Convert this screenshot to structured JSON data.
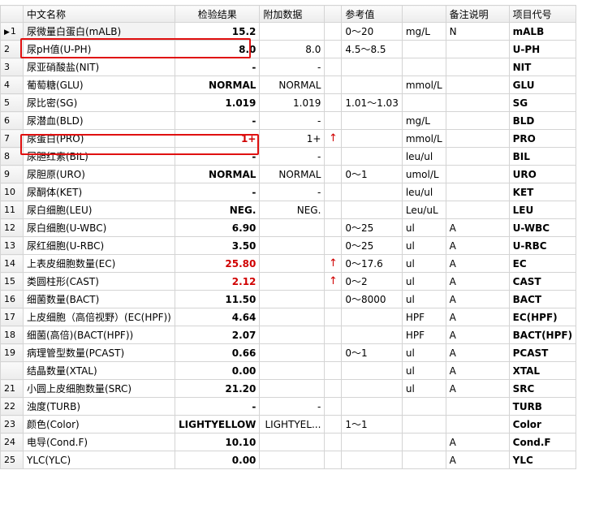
{
  "headers": [
    "",
    "中文名称",
    "检验结果",
    "附加数据",
    "",
    "参考值",
    "",
    "备注说明",
    "项目代号"
  ],
  "rows": [
    {
      "no": "1",
      "name": "尿微量白蛋白(mALB)",
      "result": "15.2",
      "extra": "",
      "flag": "",
      "ref": "0～20",
      "unit": "mg/L",
      "note": "N",
      "code": "mALB",
      "high": false
    },
    {
      "no": "2",
      "name": "尿pH值(U-PH)",
      "result": "8.0",
      "extra": "8.0",
      "flag": "",
      "ref": "4.5～8.5",
      "unit": "",
      "note": "",
      "code": "U-PH",
      "high": false
    },
    {
      "no": "3",
      "name": "尿亚硝酸盐(NIT)",
      "result": "-",
      "extra": "-",
      "flag": "",
      "ref": "",
      "unit": "",
      "note": "",
      "code": "NIT",
      "high": false
    },
    {
      "no": "4",
      "name": "葡萄糖(GLU)",
      "result": "NORMAL",
      "extra": "NORMAL",
      "flag": "",
      "ref": "",
      "unit": "mmol/L",
      "note": "",
      "code": "GLU",
      "high": false
    },
    {
      "no": "5",
      "name": "尿比密(SG)",
      "result": "1.019",
      "extra": "1.019",
      "flag": "",
      "ref": "1.01～1.03",
      "unit": "",
      "note": "",
      "code": "SG",
      "high": false
    },
    {
      "no": "6",
      "name": "尿潜血(BLD)",
      "result": "-",
      "extra": "-",
      "flag": "",
      "ref": "",
      "unit": "mg/L",
      "note": "",
      "code": "BLD",
      "high": false
    },
    {
      "no": "7",
      "name": "尿蛋白(PRO)",
      "result": "1+",
      "extra": "1+",
      "flag": "↑",
      "ref": "",
      "unit": "mmol/L",
      "note": "",
      "code": "PRO",
      "high": true
    },
    {
      "no": "8",
      "name": "尿胆红素(BIL)",
      "result": "-",
      "extra": "-",
      "flag": "",
      "ref": "",
      "unit": "leu/ul",
      "note": "",
      "code": "BIL",
      "high": false
    },
    {
      "no": "9",
      "name": "尿胆原(URO)",
      "result": "NORMAL",
      "extra": "NORMAL",
      "flag": "",
      "ref": "0～1",
      "unit": "umol/L",
      "note": "",
      "code": "URO",
      "high": false
    },
    {
      "no": "10",
      "name": "尿酮体(KET)",
      "result": "-",
      "extra": "-",
      "flag": "",
      "ref": "",
      "unit": "leu/ul",
      "note": "",
      "code": "KET",
      "high": false
    },
    {
      "no": "11",
      "name": "尿白细胞(LEU)",
      "result": "NEG.",
      "extra": "NEG.",
      "flag": "",
      "ref": "",
      "unit": "Leu/uL",
      "note": "",
      "code": "LEU",
      "high": false
    },
    {
      "no": "12",
      "name": "尿白细胞(U-WBC)",
      "result": "6.90",
      "extra": "",
      "flag": "",
      "ref": "0～25",
      "unit": "ul",
      "note": "A",
      "code": "U-WBC",
      "high": false
    },
    {
      "no": "13",
      "name": "尿红细胞(U-RBC)",
      "result": "3.50",
      "extra": "",
      "flag": "",
      "ref": "0～25",
      "unit": "ul",
      "note": "A",
      "code": "U-RBC",
      "high": false
    },
    {
      "no": "14",
      "name": "上表皮细胞数量(EC)",
      "result": "25.80",
      "extra": "",
      "flag": "↑",
      "ref": "0～17.6",
      "unit": "ul",
      "note": "A",
      "code": "EC",
      "high": true
    },
    {
      "no": "15",
      "name": "类圆柱形(CAST)",
      "result": "2.12",
      "extra": "",
      "flag": "↑",
      "ref": "0～2",
      "unit": "ul",
      "note": "A",
      "code": "CAST",
      "high": true
    },
    {
      "no": "16",
      "name": "细菌数量(BACT)",
      "result": "11.50",
      "extra": "",
      "flag": "",
      "ref": "0～8000",
      "unit": "ul",
      "note": "A",
      "code": "BACT",
      "high": false
    },
    {
      "no": "17",
      "name": "上皮细胞（高倍视野）(EC(HPF))",
      "result": "4.64",
      "extra": "",
      "flag": "",
      "ref": "",
      "unit": "HPF",
      "note": "A",
      "code": "EC(HPF)",
      "high": false
    },
    {
      "no": "18",
      "name": "细菌(高倍)(BACT(HPF))",
      "result": "2.07",
      "extra": "",
      "flag": "",
      "ref": "",
      "unit": "HPF",
      "note": "A",
      "code": "BACT(HPF)",
      "high": false
    },
    {
      "no": "19",
      "name": "病理管型数量(PCAST)",
      "result": "0.66",
      "extra": "",
      "flag": "",
      "ref": "0～1",
      "unit": "ul",
      "note": "A",
      "code": "PCAST",
      "high": false
    },
    {
      "no": "",
      "name": "结晶数量(XTAL)",
      "result": "0.00",
      "extra": "",
      "flag": "",
      "ref": "",
      "unit": "ul",
      "note": "A",
      "code": "XTAL",
      "high": false
    },
    {
      "no": "21",
      "name": "小圆上皮细胞数量(SRC)",
      "result": "21.20",
      "extra": "",
      "flag": "",
      "ref": "",
      "unit": "ul",
      "note": "A",
      "code": "SRC",
      "high": false
    },
    {
      "no": "22",
      "name": "浊度(TURB)",
      "result": "-",
      "extra": "-",
      "flag": "",
      "ref": "",
      "unit": "",
      "note": "",
      "code": "TURB",
      "high": false
    },
    {
      "no": "23",
      "name": "颜色(Color)",
      "result": "LIGHTYELLOW",
      "extra": "LIGHTYEL...",
      "flag": "",
      "ref": "1～1",
      "unit": "",
      "note": "",
      "code": "Color",
      "high": false
    },
    {
      "no": "24",
      "name": "电导(Cond.F)",
      "result": "10.10",
      "extra": "",
      "flag": "",
      "ref": "",
      "unit": "",
      "note": "A",
      "code": "Cond.F",
      "high": false
    },
    {
      "no": "25",
      "name": "YLC(YLC)",
      "result": "0.00",
      "extra": "",
      "flag": "",
      "ref": "",
      "unit": "",
      "note": "A",
      "code": "YLC",
      "high": false
    }
  ],
  "current_row_marker": "▶",
  "colors": {
    "high_value": "#d00000",
    "highlight_box": "#e01010"
  }
}
